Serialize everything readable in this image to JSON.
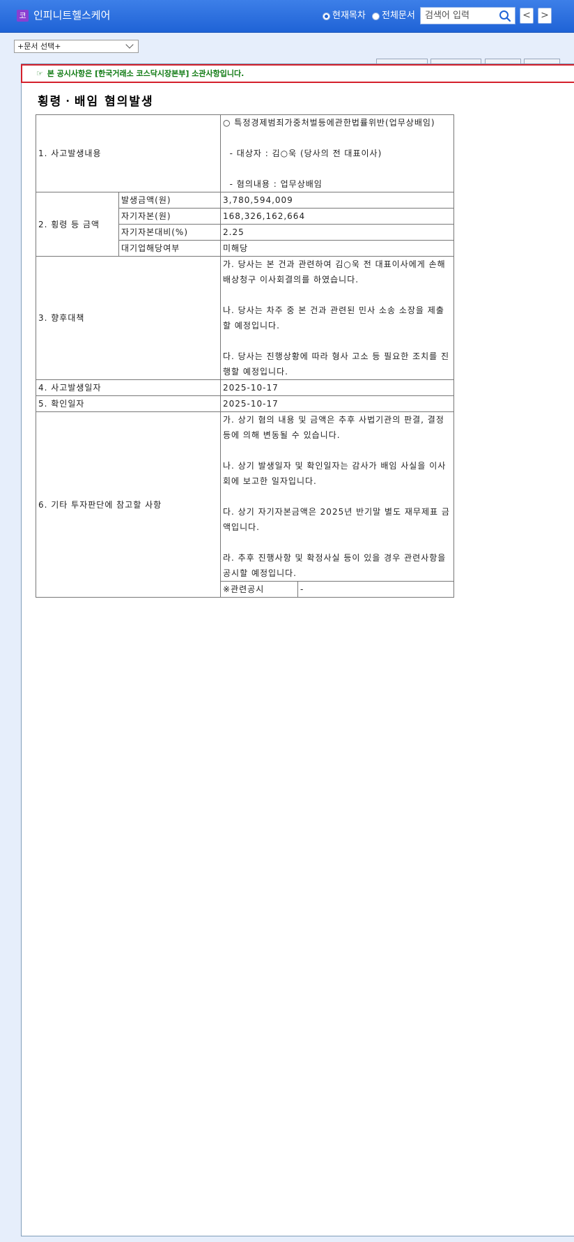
{
  "header": {
    "company_icon": "코",
    "company_name": "인피니트헬스케어",
    "radio_current": "현재목차",
    "radio_all": "전체문서",
    "search_placeholder": "검색어 입력",
    "prev": "<",
    "next": ">"
  },
  "doc_select": {
    "value": "+문서 선택+"
  },
  "notice": {
    "mark": "☞",
    "text": "본 공시사항은 [한국거래소 코스닥시장본부] 소관사항입니다."
  },
  "document": {
    "title": "횡령ㆍ배임 혐의발생",
    "row1_label": "1. 사고발생내용",
    "row1_value": "○ 특정경제범죄가중처벌등에관한법률위반(업무상배임)\n\n  - 대상자 : 김○욱 (당사의 전 대표이사)\n\n  - 혐의내용 : 업무상배임",
    "row2_label": "2. 횡령 등 금액",
    "row2_items": [
      {
        "label": "발생금액(원)",
        "value": "3,780,594,009"
      },
      {
        "label": "자기자본(원)",
        "value": "168,326,162,664"
      },
      {
        "label": "자기자본대비(%)",
        "value": "2.25"
      },
      {
        "label": "대기업해당여부",
        "value": "미해당"
      }
    ],
    "row3_label": "3. 향후대책",
    "row3_value": "가. 당사는 본 건과 관련하여 김○욱 전 대표이사에게 손해배상청구 이사회결의를 하였습니다.\n\n나. 당사는 차주 중 본 건과 관련된 민사 소송 소장을 제출할 예정입니다.\n\n다. 당사는 진행상황에 따라 형사 고소 등 필요한 조치를 진행할 예정입니다.",
    "row4_label": "4. 사고발생일자",
    "row4_value": "2025-10-17",
    "row5_label": "5. 확인일자",
    "row5_value": "2025-10-17",
    "row6_label": "6. 기타 투자판단에 참고할 사항",
    "row6_value": "가. 상기 혐의 내용 및 금액은 추후 사법기관의 판결, 결정 등에 의해 변동될 수 있습니다.\n\n나. 상기 발생일자 및 확인일자는 감사가 배임 사실을 이사회에 보고한 일자입니다.\n\n다. 상기 자기자본금액은 2025년 반기말 별도 재무제표 금액입니다.\n\n라. 추후 진행사항 및 확정사실 등이 있을 경우 관련사항을 공시할 예정입니다.",
    "related_label": "※관련공시",
    "related_value": "-"
  },
  "colors": {
    "header": "#1f63d6",
    "notice_border": "#d4202b",
    "notice_text": "#0f7a12",
    "page_bg": "#e6eefb"
  },
  "icons": {
    "search": "search-icon",
    "prev": "chevron-left-icon",
    "next": "chevron-right-icon",
    "select": "chevron-down-icon"
  }
}
